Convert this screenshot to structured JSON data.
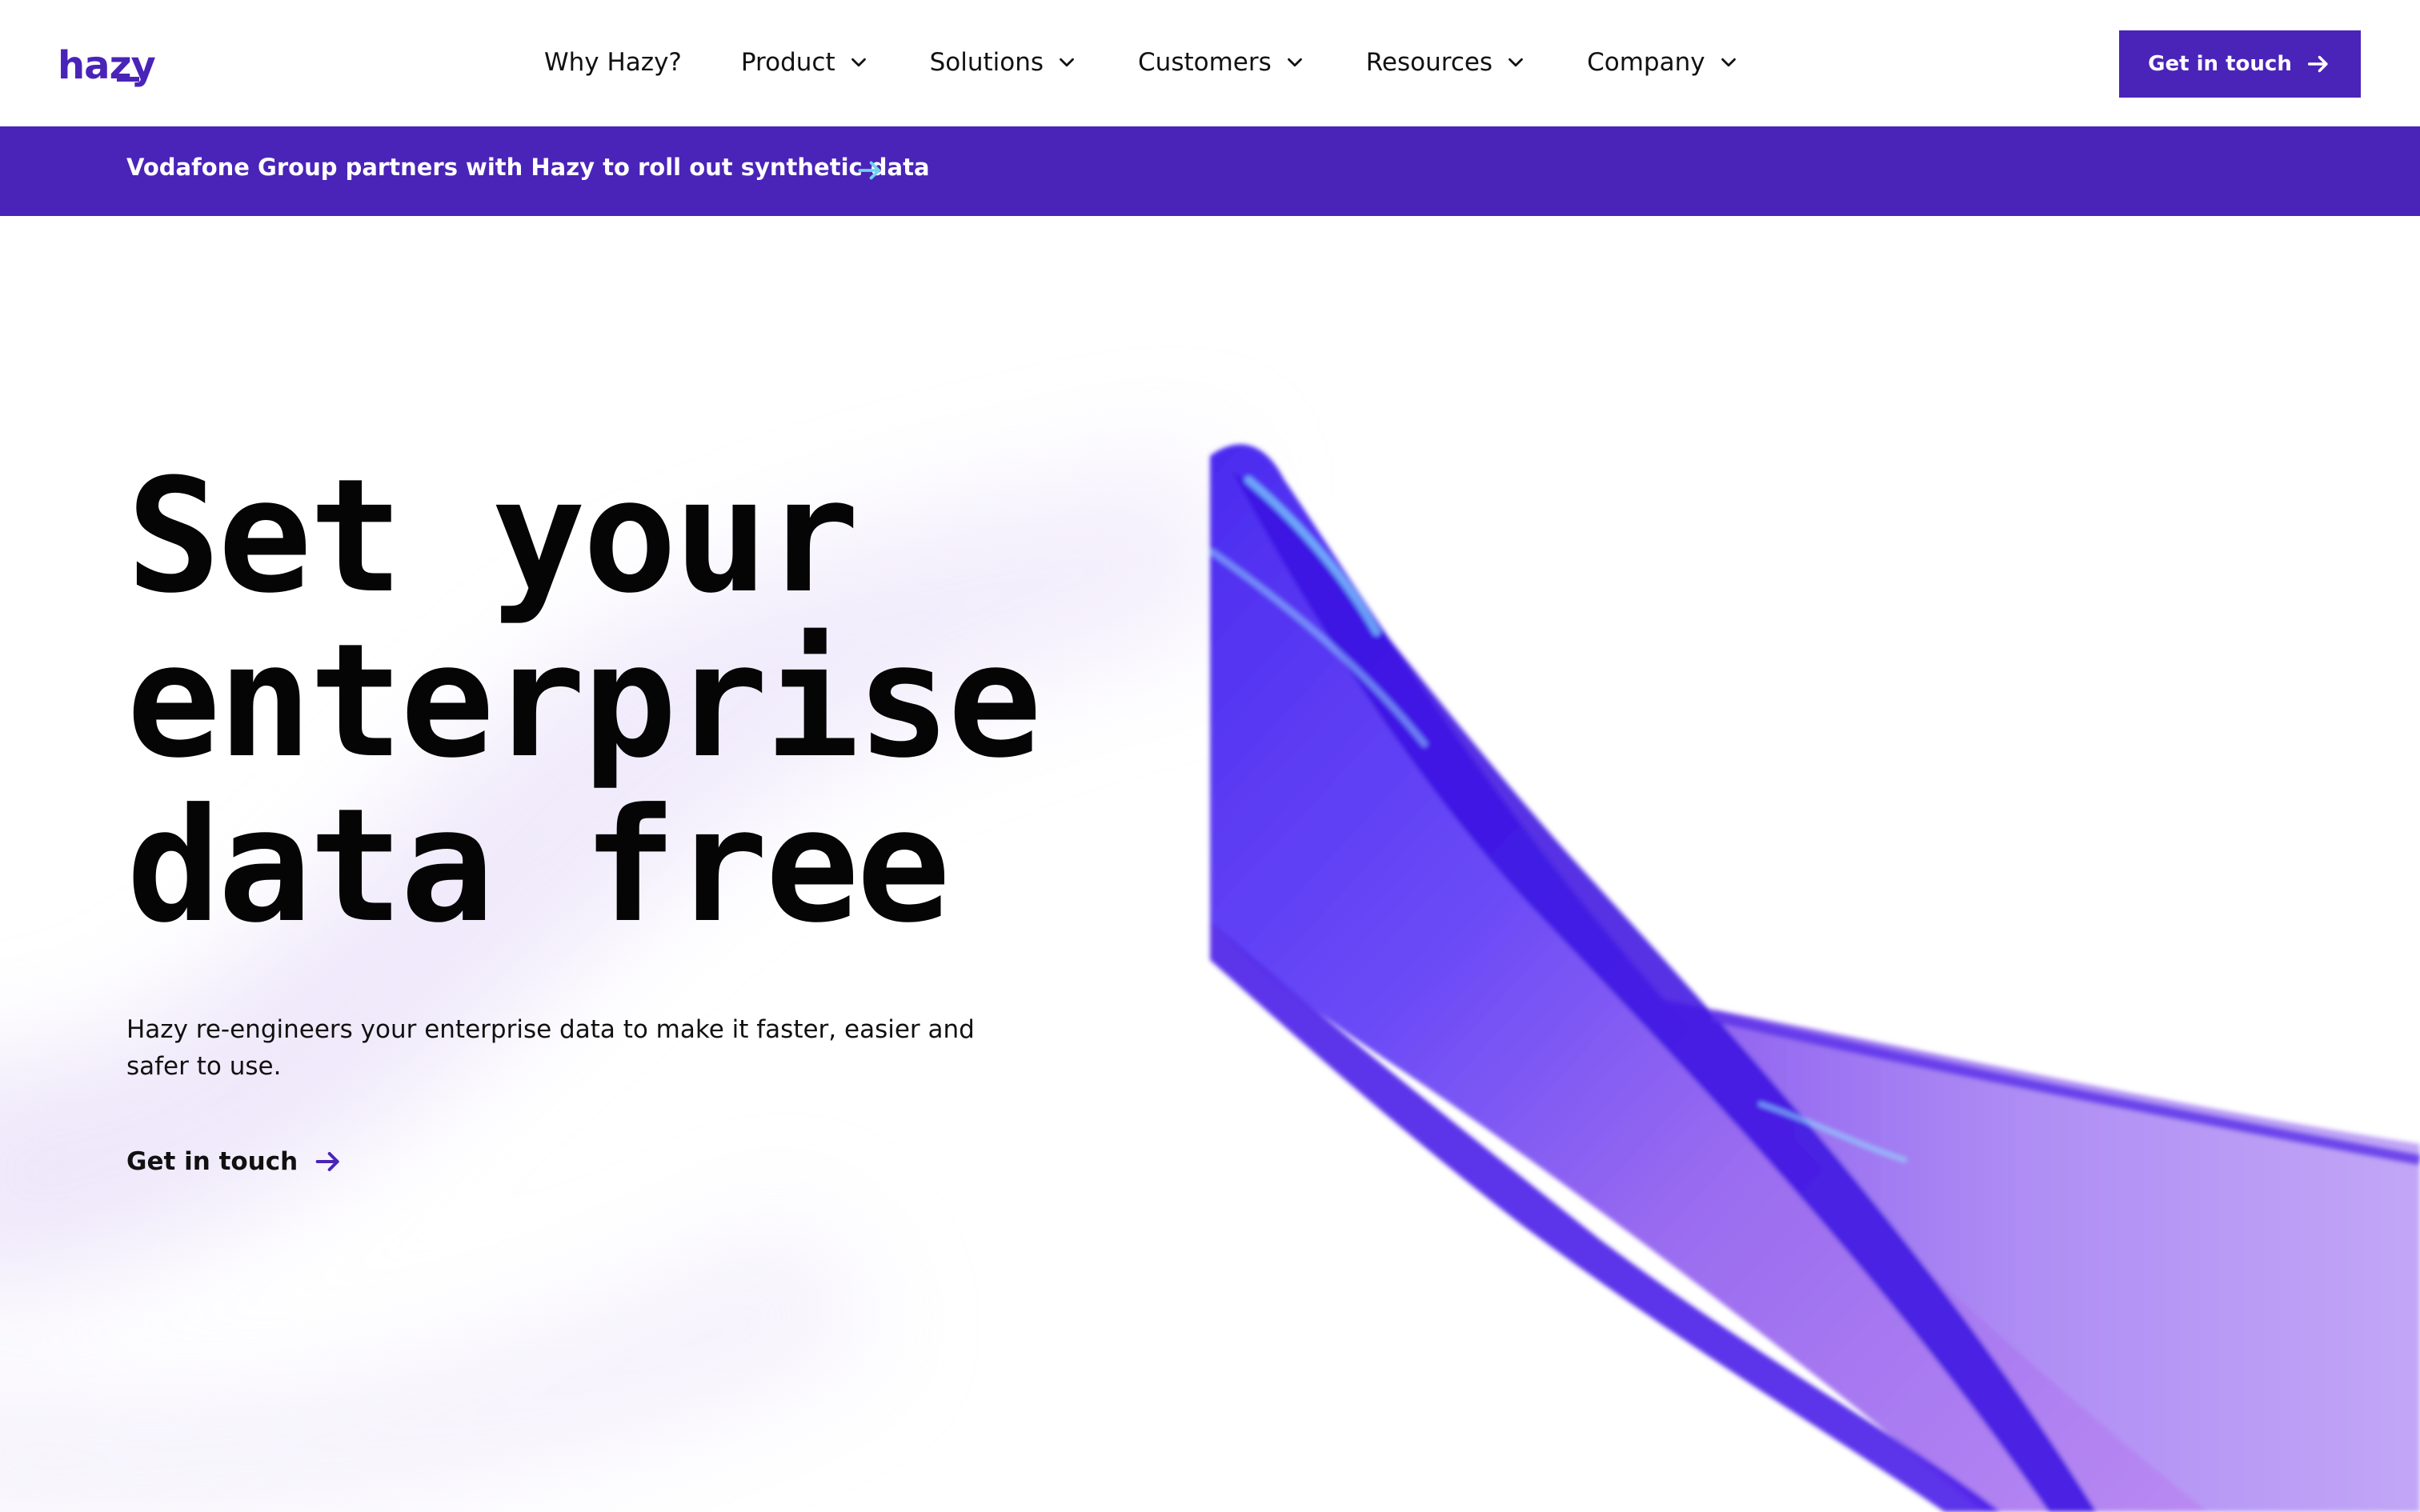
{
  "nav": {
    "logo": "hazy",
    "items": [
      {
        "label": "Why Hazy?",
        "dropdown": false
      },
      {
        "label": "Product",
        "dropdown": true
      },
      {
        "label": "Solutions",
        "dropdown": true
      },
      {
        "label": "Customers",
        "dropdown": true
      },
      {
        "label": "Resources",
        "dropdown": true
      },
      {
        "label": "Company",
        "dropdown": true
      }
    ],
    "cta_label": "Get in touch"
  },
  "banner": {
    "text": "Vodafone Group partners with Hazy to roll out synthetic data"
  },
  "hero": {
    "title_lines": [
      "Set your",
      "enterprise",
      "data free"
    ],
    "subtitle": "Hazy re-engineers your enterprise data to make it faster, easier and safer to use.",
    "link_label": "Get in touch"
  },
  "colors": {
    "brand": "#4a24b8",
    "banner_arrow": "#6fd3f5",
    "ribbon_deep": "#3a12e0",
    "ribbon_light": "#b487f0"
  },
  "icons": [
    "chevron-down-icon",
    "arrow-right-icon"
  ]
}
